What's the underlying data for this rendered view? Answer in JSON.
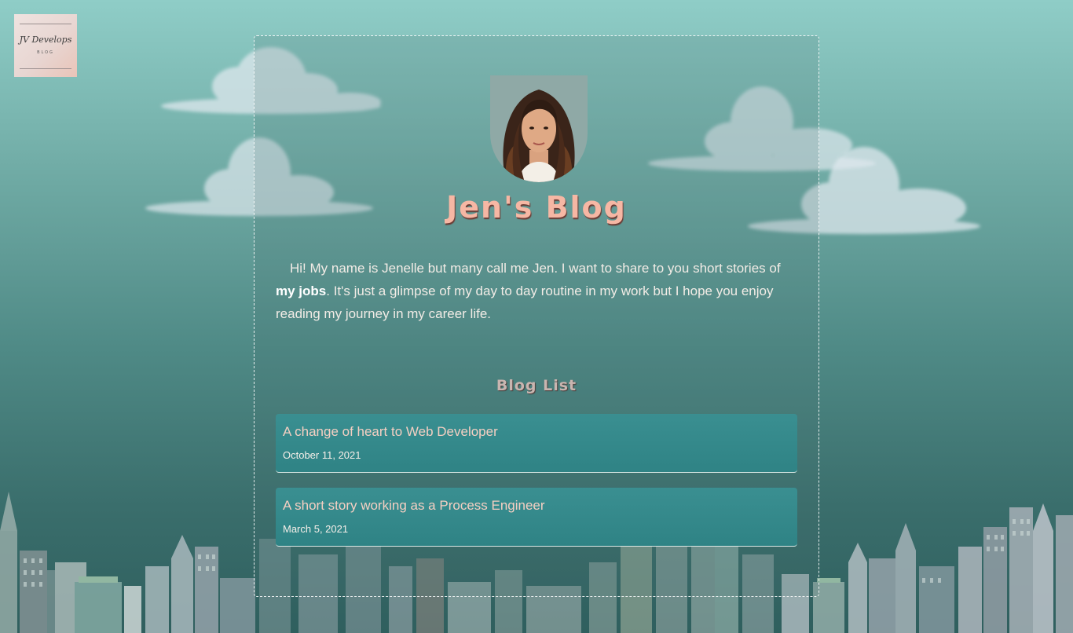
{
  "logo": {
    "script_text": "JV Develops",
    "sub_text": "BLOG"
  },
  "header": {
    "title": "Jen's Blog"
  },
  "intro": {
    "before_bold": "Hi! My name is Jenelle but many call me Jen. I want to share to you short stories of ",
    "bold": "my jobs",
    "after_bold": ". It's just a glimpse of my day to day routine in my work but I hope you enjoy reading my journey in my career life."
  },
  "blog_list": {
    "heading": "Blog List",
    "posts": [
      {
        "title": "A change of heart to Web Developer",
        "date": "October 11, 2021"
      },
      {
        "title": "A short story working as a Process Engineer",
        "date": "March 5, 2021"
      }
    ]
  },
  "colors": {
    "accent": "#f6b7a4",
    "post_background": "#3a8f91",
    "card_border": "#ffffff"
  }
}
